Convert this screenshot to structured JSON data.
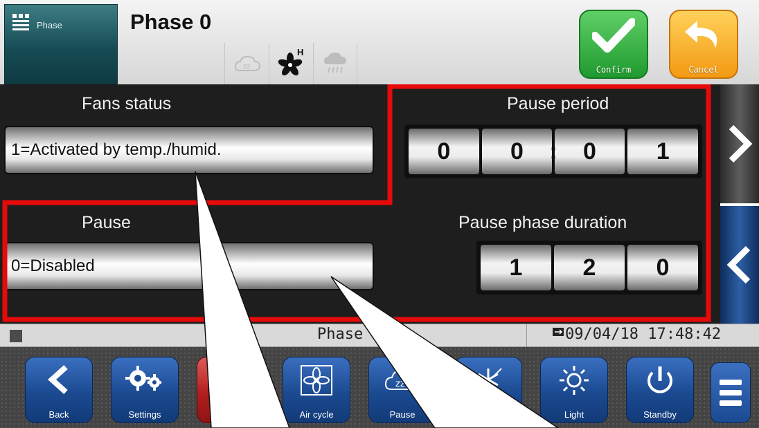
{
  "header": {
    "tile_label": "Phase",
    "title": "Phase 0",
    "status_icons": [
      "sleep-cloud-icon",
      "fan-humidity-icon",
      "rain-cloud-icon"
    ],
    "fan_badge": "H",
    "confirm_label": "Confirm",
    "cancel_label": "Cancel"
  },
  "fields": {
    "fans_status": {
      "title": "Fans status",
      "value": "1=Activated by temp./humid."
    },
    "pause_period": {
      "title": "Pause period",
      "digits": [
        "0",
        "0",
        "0",
        "1"
      ],
      "separator": ":"
    },
    "pause": {
      "title": "Pause",
      "value": "0=Disabled"
    },
    "pause_phase_duration": {
      "title": "Pause phase duration",
      "digits": [
        "1",
        "2",
        "0"
      ]
    }
  },
  "status_bar": {
    "phase": "Phase 4/4",
    "datetime": "09/04/18 17:48:42"
  },
  "toolbar": {
    "buttons": [
      {
        "label": "Back",
        "icon": "back-icon"
      },
      {
        "label": "Settings",
        "icon": "settings-icon"
      },
      {
        "label": "A",
        "icon": "alarm-icon"
      },
      {
        "label": "Air cycle",
        "icon": "fan-icon"
      },
      {
        "label": "Pause",
        "icon": "sleep-cloud-icon"
      },
      {
        "label": "",
        "icon": "defrost-icon"
      },
      {
        "label": "Light",
        "icon": "light-icon"
      },
      {
        "label": "Standby",
        "icon": "power-icon"
      }
    ],
    "menu_icon": "menu-icon"
  },
  "colors": {
    "highlight_frame": "#e60a0a",
    "confirm": "#2ca83a",
    "cancel": "#f5a623",
    "toolbar_button": "#1f4f96",
    "panel_background": "#1e1e1e"
  }
}
